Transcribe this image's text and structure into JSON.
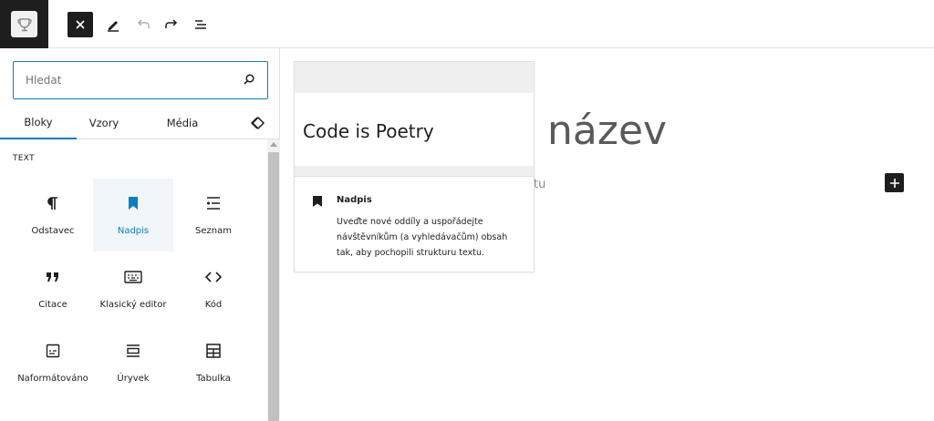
{
  "toolbar": {
    "logo_icon": "trophy-logo-icon",
    "close_icon": "close-icon",
    "tools_icon": "pencil-icon",
    "undo_icon": "undo-icon",
    "redo_icon": "redo-icon",
    "list_view_icon": "list-view-icon"
  },
  "inserter": {
    "search": {
      "placeholder": "Hledat",
      "value": ""
    },
    "tabs": [
      {
        "label": "Bloky",
        "active": true
      },
      {
        "label": "Vzory",
        "active": false
      },
      {
        "label": "Média",
        "active": false
      }
    ],
    "section_title": "TEXT",
    "blocks": [
      {
        "label": "Odstavec",
        "icon": "paragraph-icon",
        "selected": false
      },
      {
        "label": "Nadpis",
        "icon": "bookmark-icon",
        "selected": true
      },
      {
        "label": "Seznam",
        "icon": "list-icon",
        "selected": false
      },
      {
        "label": "Citace",
        "icon": "quote-icon",
        "selected": false
      },
      {
        "label": "Klasický editor",
        "icon": "keyboard-icon",
        "selected": false
      },
      {
        "label": "Kód",
        "icon": "code-icon",
        "selected": false
      },
      {
        "label": "Naformátováno",
        "icon": "preformatted-icon",
        "selected": false
      },
      {
        "label": "Úryvek",
        "icon": "pullquote-icon",
        "selected": false
      },
      {
        "label": "Tabulka",
        "icon": "table-icon",
        "selected": false
      }
    ]
  },
  "editor": {
    "title_fragment": "název",
    "paragraph_fragment": "tu"
  },
  "preview": {
    "sample_text": "Code is Poetry",
    "block_name": "Nadpis",
    "description": "Uveďte nové oddíly a uspořádejte návštěvníkům (a vyhledávačům) obsah tak, aby pochopili strukturu textu."
  },
  "colors": {
    "accent": "#0a7fbf",
    "dark": "#1e1e1e",
    "selected_bg": "#f0f6fa"
  }
}
